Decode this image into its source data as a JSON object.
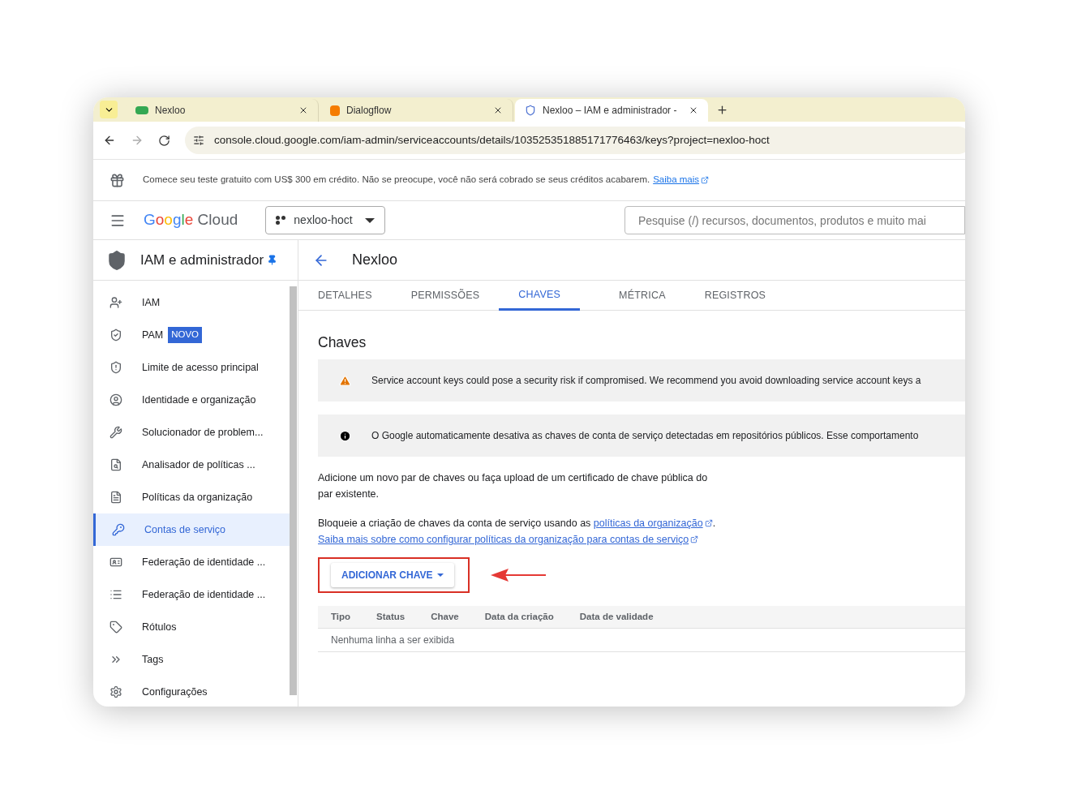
{
  "browser": {
    "tabs": [
      {
        "title": "Nexloo",
        "selected": false
      },
      {
        "title": "Dialogflow",
        "selected": false
      },
      {
        "title": "Nexloo – IAM e administrador -",
        "selected": true
      }
    ],
    "url": "console.cloud.google.com/iam-admin/serviceaccounts/details/103525351885171776463/keys?project=nexloo-hoct"
  },
  "banner": {
    "text": "Comece seu teste gratuito com US$ 300 em crédito. Não se preocupe, você não será cobrado se seus créditos acabarem.",
    "link": "Saiba mais"
  },
  "header": {
    "logo": "Google Cloud",
    "project": "nexloo-hoct",
    "search": {
      "placeholder": "Pesquise (/) recursos, documentos, produtos e muito mai"
    }
  },
  "sidebar": {
    "title": "IAM e administrador",
    "items": [
      {
        "label": "IAM",
        "selected": false
      },
      {
        "label": "PAM",
        "badge": "NOVO",
        "selected": false
      },
      {
        "label": "Limite de acesso principal",
        "selected": false
      },
      {
        "label": "Identidade e organização",
        "selected": false
      },
      {
        "label": "Solucionador de problem...",
        "selected": false
      },
      {
        "label": "Analisador de políticas ...",
        "selected": false
      },
      {
        "label": "Políticas da organização",
        "selected": false
      },
      {
        "label": "Contas de serviço",
        "selected": true
      },
      {
        "label": "Federação de identidade ...",
        "selected": false
      },
      {
        "label": "Federação de identidade ...",
        "selected": false
      },
      {
        "label": "Rótulos",
        "selected": false
      },
      {
        "label": "Tags",
        "selected": false
      },
      {
        "label": "Configurações",
        "selected": false
      }
    ]
  },
  "page": {
    "title": "Nexloo",
    "tabs": [
      {
        "label": "DETALHES",
        "selected": false
      },
      {
        "label": "PERMISSÕES",
        "selected": false
      },
      {
        "label": "CHAVES",
        "selected": true
      },
      {
        "label": "MÉTRICA",
        "selected": false
      },
      {
        "label": "REGISTROS",
        "selected": false
      }
    ],
    "heading": "Chaves",
    "alerts": [
      {
        "kind": "warning",
        "text": "Service account keys could pose a security risk if compromised. We recommend you avoid downloading service account keys a"
      },
      {
        "kind": "info",
        "text": "O Google automaticamente desativa as chaves de conta de serviço detectadas em repositórios públicos. Esse comportamento"
      }
    ],
    "description": "Adicione um novo par de chaves ou faça upload de um certificado de chave pública do par existente.",
    "policy_text": "Bloqueie a criação de chaves da conta de serviço usando as",
    "policy_link": "políticas da organização",
    "policy_end": ".",
    "learn_link": "Saiba mais sobre como configurar políticas da organização para contas de serviço",
    "add_button": "ADICIONAR CHAVE",
    "table": {
      "columns": [
        "Tipo",
        "Status",
        "Chave",
        "Data da criação",
        "Data de validade"
      ],
      "empty": "Nenhuma linha a ser exibida"
    }
  }
}
